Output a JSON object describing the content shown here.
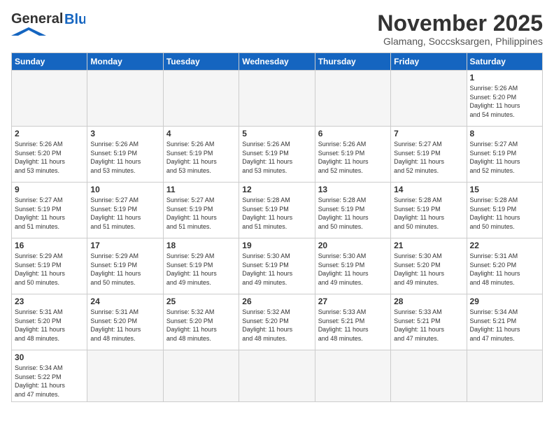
{
  "header": {
    "logo_general": "General",
    "logo_blue": "Blue",
    "month": "November 2025",
    "location": "Glamang, Soccsksargen, Philippines"
  },
  "weekdays": [
    "Sunday",
    "Monday",
    "Tuesday",
    "Wednesday",
    "Thursday",
    "Friday",
    "Saturday"
  ],
  "days": [
    {
      "num": "",
      "info": ""
    },
    {
      "num": "",
      "info": ""
    },
    {
      "num": "",
      "info": ""
    },
    {
      "num": "",
      "info": ""
    },
    {
      "num": "",
      "info": ""
    },
    {
      "num": "",
      "info": ""
    },
    {
      "num": "1",
      "info": "Sunrise: 5:26 AM\nSunset: 5:20 PM\nDaylight: 11 hours\nand 54 minutes."
    },
    {
      "num": "2",
      "info": "Sunrise: 5:26 AM\nSunset: 5:20 PM\nDaylight: 11 hours\nand 53 minutes."
    },
    {
      "num": "3",
      "info": "Sunrise: 5:26 AM\nSunset: 5:19 PM\nDaylight: 11 hours\nand 53 minutes."
    },
    {
      "num": "4",
      "info": "Sunrise: 5:26 AM\nSunset: 5:19 PM\nDaylight: 11 hours\nand 53 minutes."
    },
    {
      "num": "5",
      "info": "Sunrise: 5:26 AM\nSunset: 5:19 PM\nDaylight: 11 hours\nand 53 minutes."
    },
    {
      "num": "6",
      "info": "Sunrise: 5:26 AM\nSunset: 5:19 PM\nDaylight: 11 hours\nand 52 minutes."
    },
    {
      "num": "7",
      "info": "Sunrise: 5:27 AM\nSunset: 5:19 PM\nDaylight: 11 hours\nand 52 minutes."
    },
    {
      "num": "8",
      "info": "Sunrise: 5:27 AM\nSunset: 5:19 PM\nDaylight: 11 hours\nand 52 minutes."
    },
    {
      "num": "9",
      "info": "Sunrise: 5:27 AM\nSunset: 5:19 PM\nDaylight: 11 hours\nand 51 minutes."
    },
    {
      "num": "10",
      "info": "Sunrise: 5:27 AM\nSunset: 5:19 PM\nDaylight: 11 hours\nand 51 minutes."
    },
    {
      "num": "11",
      "info": "Sunrise: 5:27 AM\nSunset: 5:19 PM\nDaylight: 11 hours\nand 51 minutes."
    },
    {
      "num": "12",
      "info": "Sunrise: 5:28 AM\nSunset: 5:19 PM\nDaylight: 11 hours\nand 51 minutes."
    },
    {
      "num": "13",
      "info": "Sunrise: 5:28 AM\nSunset: 5:19 PM\nDaylight: 11 hours\nand 50 minutes."
    },
    {
      "num": "14",
      "info": "Sunrise: 5:28 AM\nSunset: 5:19 PM\nDaylight: 11 hours\nand 50 minutes."
    },
    {
      "num": "15",
      "info": "Sunrise: 5:28 AM\nSunset: 5:19 PM\nDaylight: 11 hours\nand 50 minutes."
    },
    {
      "num": "16",
      "info": "Sunrise: 5:29 AM\nSunset: 5:19 PM\nDaylight: 11 hours\nand 50 minutes."
    },
    {
      "num": "17",
      "info": "Sunrise: 5:29 AM\nSunset: 5:19 PM\nDaylight: 11 hours\nand 50 minutes."
    },
    {
      "num": "18",
      "info": "Sunrise: 5:29 AM\nSunset: 5:19 PM\nDaylight: 11 hours\nand 49 minutes."
    },
    {
      "num": "19",
      "info": "Sunrise: 5:30 AM\nSunset: 5:19 PM\nDaylight: 11 hours\nand 49 minutes."
    },
    {
      "num": "20",
      "info": "Sunrise: 5:30 AM\nSunset: 5:19 PM\nDaylight: 11 hours\nand 49 minutes."
    },
    {
      "num": "21",
      "info": "Sunrise: 5:30 AM\nSunset: 5:20 PM\nDaylight: 11 hours\nand 49 minutes."
    },
    {
      "num": "22",
      "info": "Sunrise: 5:31 AM\nSunset: 5:20 PM\nDaylight: 11 hours\nand 48 minutes."
    },
    {
      "num": "23",
      "info": "Sunrise: 5:31 AM\nSunset: 5:20 PM\nDaylight: 11 hours\nand 48 minutes."
    },
    {
      "num": "24",
      "info": "Sunrise: 5:31 AM\nSunset: 5:20 PM\nDaylight: 11 hours\nand 48 minutes."
    },
    {
      "num": "25",
      "info": "Sunrise: 5:32 AM\nSunset: 5:20 PM\nDaylight: 11 hours\nand 48 minutes."
    },
    {
      "num": "26",
      "info": "Sunrise: 5:32 AM\nSunset: 5:20 PM\nDaylight: 11 hours\nand 48 minutes."
    },
    {
      "num": "27",
      "info": "Sunrise: 5:33 AM\nSunset: 5:21 PM\nDaylight: 11 hours\nand 48 minutes."
    },
    {
      "num": "28",
      "info": "Sunrise: 5:33 AM\nSunset: 5:21 PM\nDaylight: 11 hours\nand 47 minutes."
    },
    {
      "num": "29",
      "info": "Sunrise: 5:34 AM\nSunset: 5:21 PM\nDaylight: 11 hours\nand 47 minutes."
    },
    {
      "num": "30",
      "info": "Sunrise: 5:34 AM\nSunset: 5:22 PM\nDaylight: 11 hours\nand 47 minutes."
    },
    {
      "num": "",
      "info": ""
    },
    {
      "num": "",
      "info": ""
    },
    {
      "num": "",
      "info": ""
    },
    {
      "num": "",
      "info": ""
    },
    {
      "num": "",
      "info": ""
    },
    {
      "num": "",
      "info": ""
    }
  ]
}
